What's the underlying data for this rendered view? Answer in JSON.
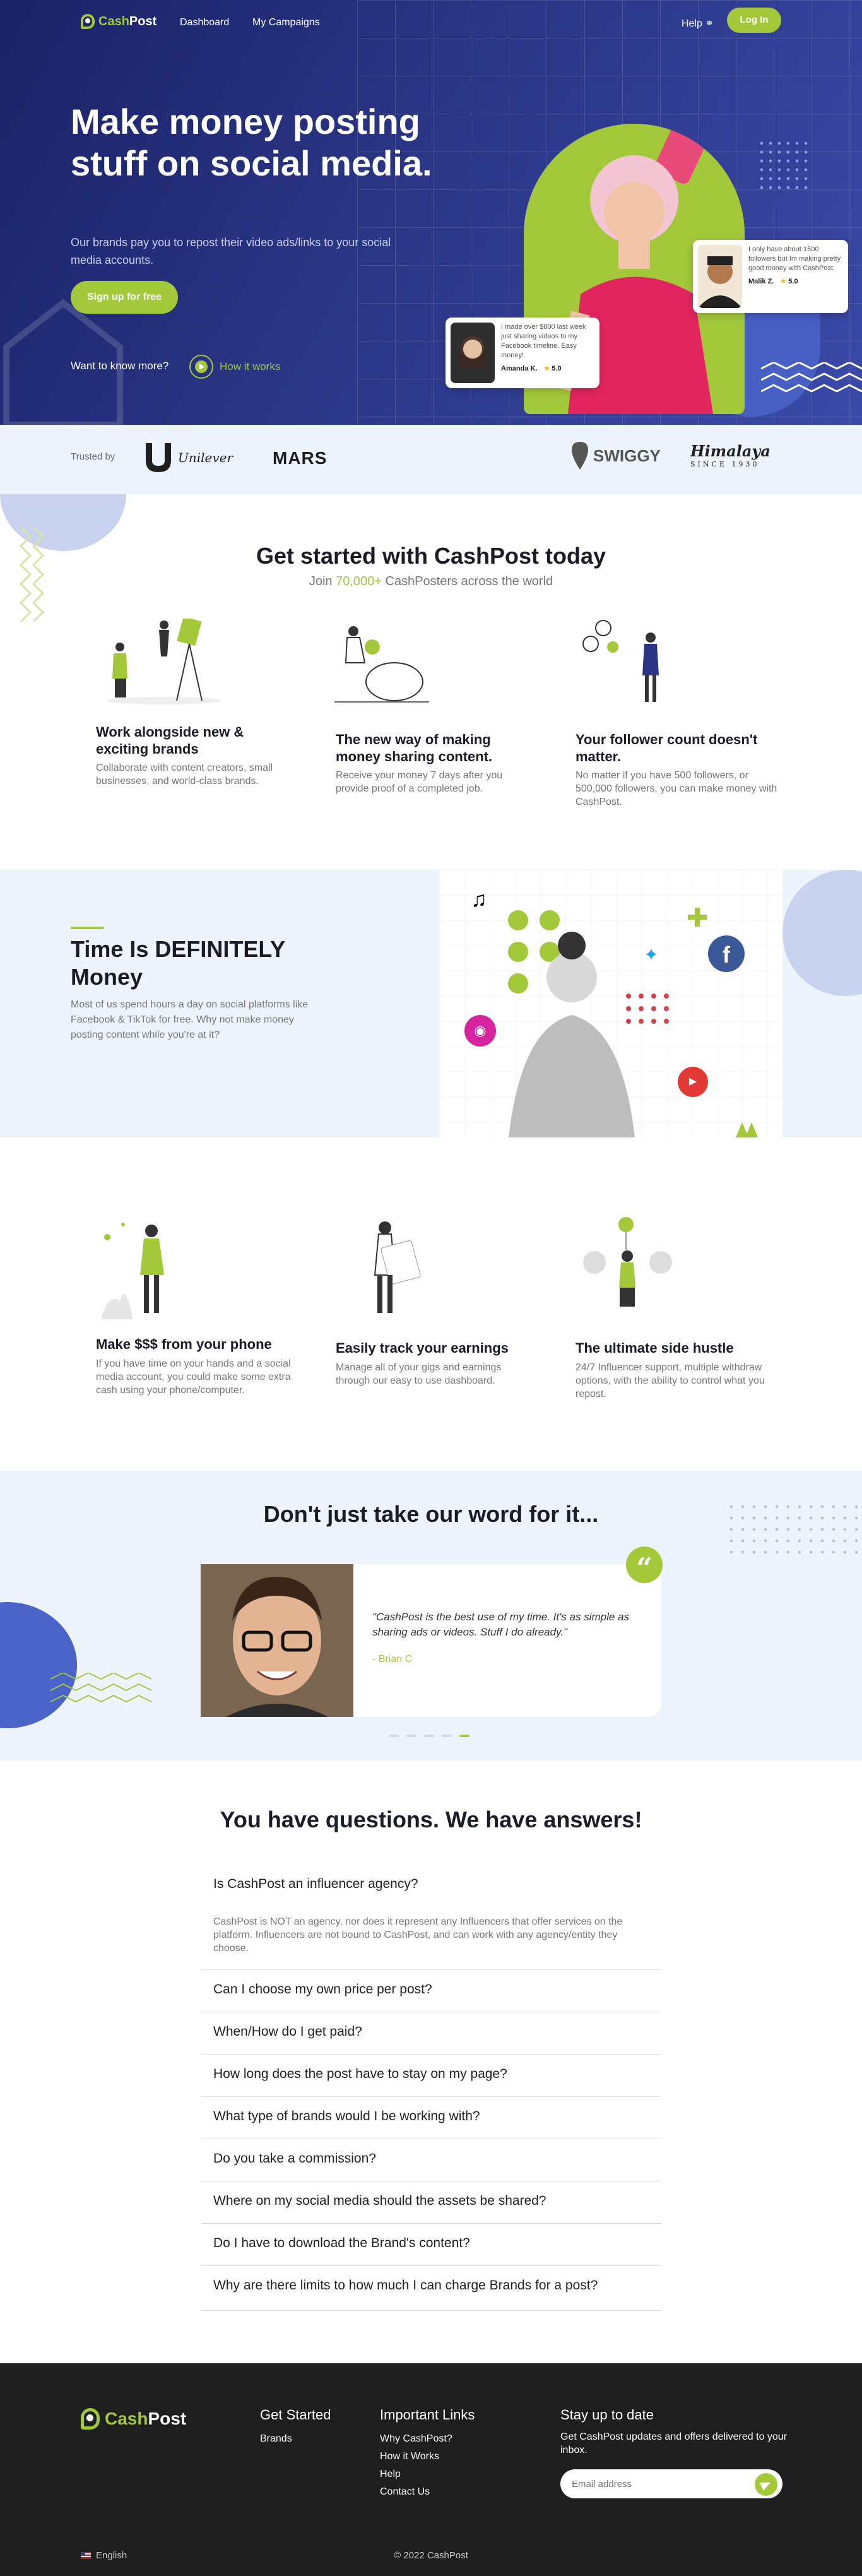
{
  "brand": {
    "cash": "Cash",
    "post": "Post"
  },
  "nav": {
    "dashboard": "Dashboard",
    "campaigns": "My Campaigns",
    "help": "Help",
    "login": "Log In"
  },
  "hero": {
    "title": "Make money posting stuff on social media.",
    "subtitle": "Our brands pay you to repost their video ads/links to your social media accounts.",
    "signup": "Sign up for free",
    "want": "Want to know more?",
    "how": "How it works",
    "review1": {
      "text": "I only have about 1500 followers but Im making pretty good money with CashPost.",
      "name": "Malik Z.",
      "rating": "5.0"
    },
    "review2": {
      "text": "I made over $800 last week just sharing videos to my Facebook timeline. Easy money!",
      "name": "Amanda K.",
      "rating": "5.0"
    }
  },
  "trusted": {
    "label": "Trusted by",
    "brands": [
      "Unilever",
      "MARS",
      "SWIGGY",
      "Himalaya",
      "SINCE 1930"
    ]
  },
  "get_started": {
    "title": "Get started with CashPost today",
    "sub_pre": "Join ",
    "sub_num": "70,000+",
    "sub_post": " CashPosters across the world",
    "features": [
      {
        "title": "Work alongside new & exciting brands",
        "desc": "Collaborate with content creators, small businesses, and world-class brands."
      },
      {
        "title": "The new way of making money sharing content.",
        "desc": "Receive your money 7 days after you provide proof of a completed job."
      },
      {
        "title": "Your follower count doesn't matter.",
        "desc": "No matter if you have 500 followers, or 500,000 followers, you can make money with CashPost."
      }
    ]
  },
  "money": {
    "title": "Time Is DEFINITELY Money",
    "desc": "Most of us spend hours a day on social platforms like Facebook & TikTok for free. Why not make money posting content while you're at it?"
  },
  "features2": [
    {
      "title": "Make $$$ from your phone",
      "desc": "If you have time on your hands and a social media account, you could make some extra cash using your phone/computer."
    },
    {
      "title": "Easily track your earnings",
      "desc": "Manage all of your gigs and earnings through our easy to use dashboard."
    },
    {
      "title": "The ultimate side hustle",
      "desc": "24/7 Influencer support, multiple withdraw options, with the ability to control what you repost."
    }
  ],
  "testimonial": {
    "title": "Don't just take our word for it...",
    "quote": "\"CashPost is the best use of my time. It's as simple as sharing ads or videos. Stuff I do already.\"",
    "by": "- Brian C"
  },
  "faq": {
    "title": "You have questions. We have answers!",
    "items": [
      "Is CashPost an influencer agency?",
      "Can I choose my own price per post?",
      "When/How do I get paid?",
      "How long does the post have to stay on my page?",
      "What type of brands would I be working with?",
      "Do you take a commission?",
      "Where on my social media should the assets be shared?",
      "Do I have to download the Brand's content?",
      "Why are there limits to how much I can charge Brands for a post?"
    ],
    "answer": "CashPost is NOT an agency, nor does it represent any Influencers that offer services on the platform. Influencers are not bound to CashPost, and can work with any agency/entity they choose."
  },
  "footer": {
    "get_started": "Get Started",
    "brands": "Brands",
    "important": "Important Links",
    "links": [
      "Why CashPost?",
      "How it Works",
      "Help",
      "Contact Us"
    ],
    "stay": "Stay up to date",
    "stay_text": "Get CashPost updates and offers delivered to your inbox.",
    "email_placeholder": "Email address",
    "lang": "English",
    "copy": "© 2022 CashPost"
  },
  "colors": {
    "accent": "#a3c93a",
    "hero": "#2a3585",
    "light_bg": "#eef4fd",
    "footer": "#1e1e1e"
  }
}
